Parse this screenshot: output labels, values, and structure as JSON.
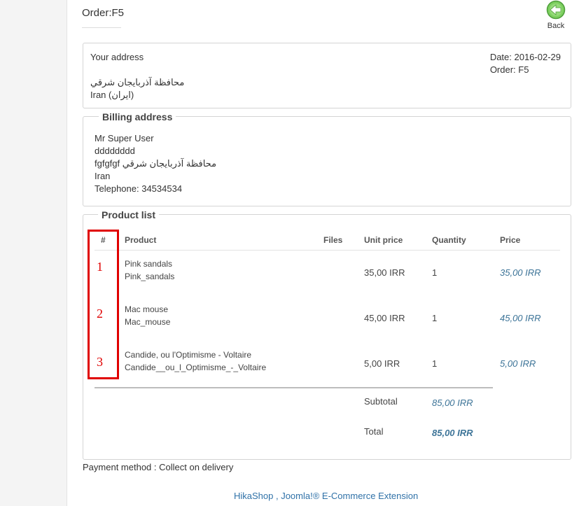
{
  "header": {
    "title": "Order:F5",
    "back_label": "Back"
  },
  "address_box": {
    "heading": "Your address",
    "line1": "محافظة آذربایجان شرقي",
    "line2": "Iran (ایران)",
    "date": "Date: 2016-02-29",
    "order": "Order: F5"
  },
  "billing": {
    "legend": "Billing address",
    "lines": [
      "Mr Super User",
      "dddddddd",
      "fgfgfgf محافظة آذربایجان شرقي",
      "Iran",
      "Telephone: 34534534"
    ]
  },
  "products": {
    "legend": "Product list",
    "columns": {
      "num": "#",
      "product": "Product",
      "files": "Files",
      "unit_price": "Unit price",
      "quantity": "Quantity",
      "price": "Price"
    },
    "rows": [
      {
        "num": "1",
        "name": "Pink sandals",
        "code": "Pink_sandals",
        "unit_price": "35,00 IRR",
        "quantity": "1",
        "price": "35,00 IRR"
      },
      {
        "num": "2",
        "name": "Mac mouse",
        "code": "Mac_mouse",
        "unit_price": "45,00 IRR",
        "quantity": "1",
        "price": "45,00 IRR"
      },
      {
        "num": "3",
        "name": "Candide, ou l'Optimisme - Voltaire",
        "code": "Candide__ou_l_Optimisme_-_Voltaire",
        "unit_price": "5,00 IRR",
        "quantity": "1",
        "price": "5,00 IRR"
      }
    ],
    "subtotal_label": "Subtotal",
    "subtotal_value": "85,00 IRR",
    "total_label": "Total",
    "total_value": "85,00 IRR"
  },
  "payment_method": "Payment method : Collect on delivery",
  "footer": {
    "link_text": "HikaShop , Joomla!® E-Commerce Extension"
  },
  "colors": {
    "accent_blue": "#3d7498",
    "highlight_red": "#e00000",
    "back_icon_green": "#5cb85c"
  }
}
